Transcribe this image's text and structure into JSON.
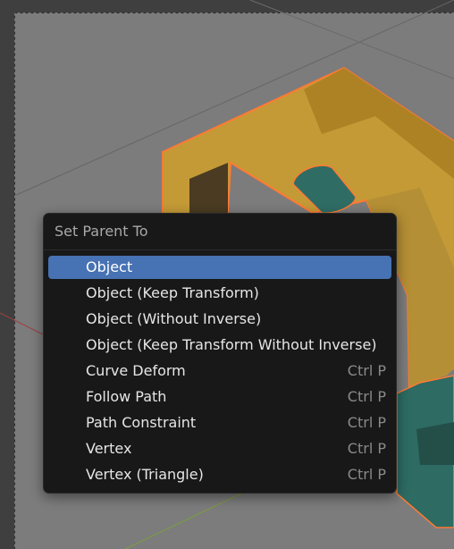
{
  "menu": {
    "title": "Set Parent To",
    "items": [
      {
        "label": "Object",
        "shortcut": "",
        "active": true
      },
      {
        "label": "Object (Keep Transform)",
        "shortcut": ""
      },
      {
        "label": "Object (Without Inverse)",
        "shortcut": ""
      },
      {
        "label": "Object (Keep Transform Without Inverse)",
        "shortcut": ""
      },
      {
        "label": "Curve Deform",
        "shortcut": "Ctrl P"
      },
      {
        "label": "Follow Path",
        "shortcut": "Ctrl P"
      },
      {
        "label": "Path Constraint",
        "shortcut": "Ctrl P"
      },
      {
        "label": "Vertex",
        "shortcut": "Ctrl P"
      },
      {
        "label": "Vertex (Triangle)",
        "shortcut": "Ctrl P"
      }
    ]
  },
  "colors": {
    "viewport_bg": "#3d3d3d",
    "menu_bg": "#181818",
    "highlight": "#4772b3",
    "object_orange": "#c79a33",
    "object_teal": "#2d6b63",
    "selection_outline": "#ff7a33"
  }
}
